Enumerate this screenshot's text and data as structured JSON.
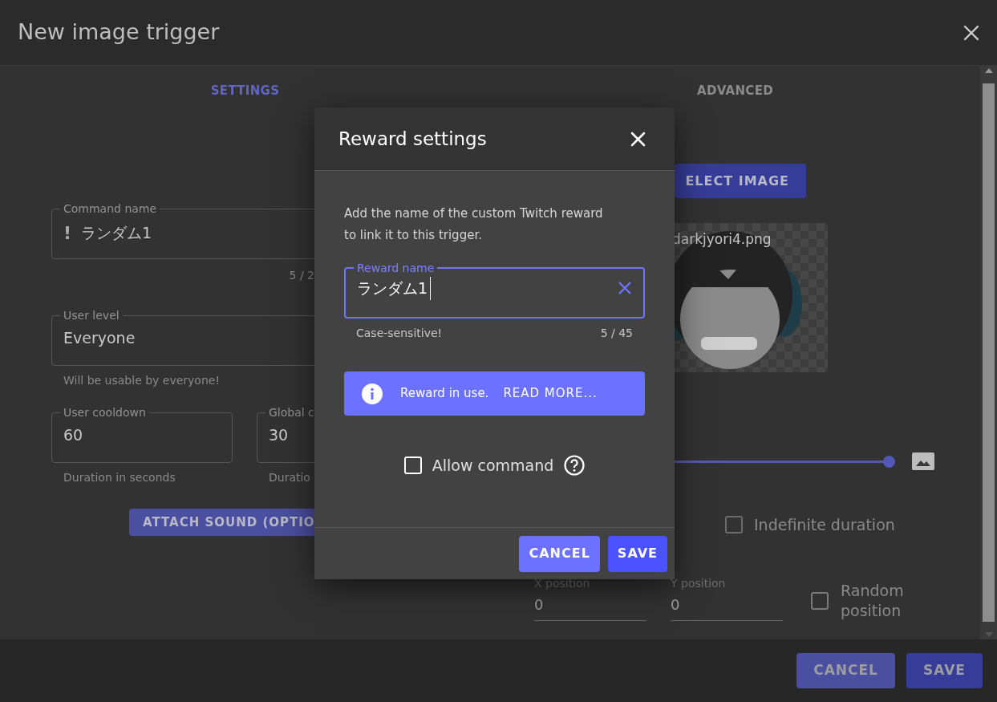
{
  "window": {
    "title": "New image trigger"
  },
  "tabs": [
    {
      "label": "SETTINGS",
      "selected": true
    },
    {
      "label": "ADVANCED",
      "selected": false
    }
  ],
  "settings": {
    "command_name": {
      "label": "Command name",
      "prefix": "!",
      "value": "ランダム1",
      "counter": "5 / 2"
    },
    "user_level": {
      "label": "User level",
      "value": "Everyone",
      "helper": "Will be usable by everyone!"
    },
    "user_cooldown": {
      "label": "User cooldown",
      "value": "60",
      "helper": "Duration in seconds"
    },
    "global_cooldown": {
      "label": "Global c",
      "value": "30",
      "helper": "Duratio"
    },
    "attach_button": "ATTACH SOUND (OPTIO"
  },
  "advanced": {
    "select_button": "ELECT IMAGE",
    "image": {
      "file_name": "darkjyori4.png"
    },
    "slider": {
      "level": 1
    },
    "indefinite_duration": {
      "label": "Indefinite duration",
      "checked": false
    },
    "x_position": {
      "label": "X position",
      "value": "0"
    },
    "y_position": {
      "label": "Y position",
      "value": "0"
    },
    "random_position": {
      "label": "Random position",
      "checked": false
    }
  },
  "footer_buttons": [
    {
      "label": "CANCEL",
      "kind": "secondary"
    },
    {
      "label": "SAVE",
      "kind": "primary"
    }
  ],
  "modal": {
    "title": "Reward settings",
    "description": "Add the name of the custom Twitch reward to link it to this trigger.",
    "reward_field": {
      "label": "Reward name",
      "value": "ランダム1",
      "helper": "Case-sensitive!",
      "counter": "5 / 45",
      "focused": true
    },
    "alert": {
      "text": "Reward in use.",
      "link": "READ MORE..."
    },
    "allow_command": {
      "label": "Allow command",
      "checked": false
    },
    "buttons": [
      {
        "label": "CANCEL",
        "kind": "secondary"
      },
      {
        "label": "SAVE",
        "kind": "primary"
      }
    ]
  }
}
